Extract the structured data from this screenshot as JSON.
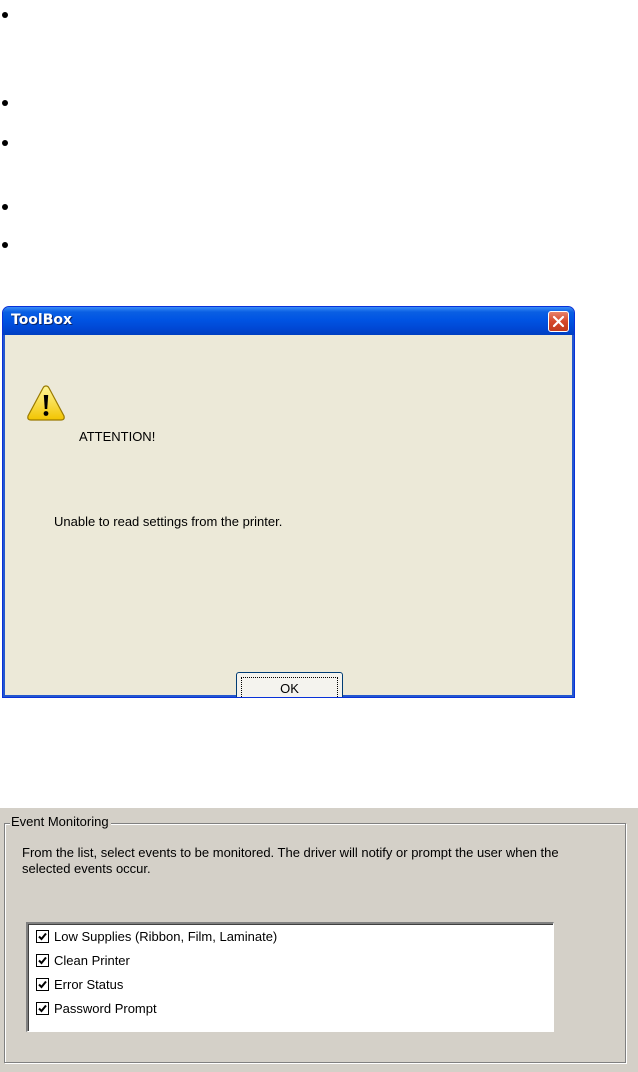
{
  "dialog": {
    "title": "ToolBox",
    "heading": "ATTENTION!",
    "message": "Unable to read settings from the printer.",
    "ok_label": "OK",
    "icon": "warning-icon"
  },
  "event_monitoring": {
    "legend": "Event Monitoring",
    "description": "From the list, select events to be monitored.  The driver will notify or prompt the user when the selected events occur.",
    "items": [
      {
        "label": "Low Supplies (Ribbon, Film, Laminate)",
        "checked": true
      },
      {
        "label": "Clean Printer",
        "checked": true
      },
      {
        "label": "Error Status",
        "checked": true
      },
      {
        "label": "Password Prompt",
        "checked": true
      }
    ]
  },
  "colors": {
    "titlebar": "#0054e3",
    "dialog_bg": "#ece9d8",
    "panel_bg": "#d4d0c8",
    "close_button": "#d5482a"
  }
}
